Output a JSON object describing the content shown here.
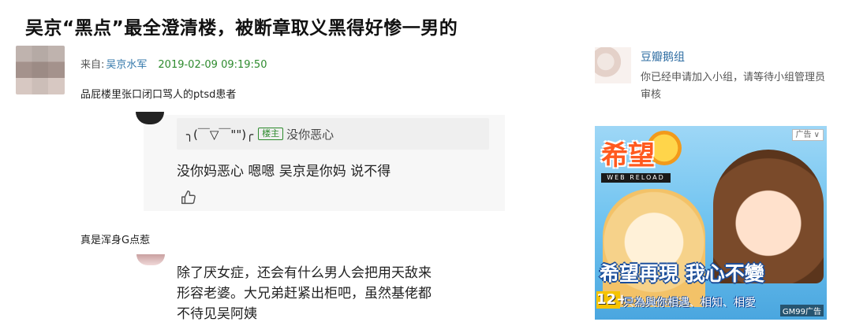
{
  "title": "吴京“黑点”最全澄清楼，被断章取义黑得好惨一男的",
  "post": {
    "from_label": "来自:",
    "author": "吴京水军",
    "date": "2019-02-09 09:19:50",
    "text": "品屁楼里张口闭口骂人的ptsd患者"
  },
  "reply1": {
    "quote_nick": "╮(￣▽￣\"\")╭",
    "badge": "楼主",
    "quote_text": "没你恶心",
    "text": "没你妈恶心 嗯嗯 吴京是你妈 说不得",
    "like_icon": "thumbs-up-icon"
  },
  "comment2": {
    "text": "真是浑身G点惹"
  },
  "reply2": {
    "lines": [
      "除了厌女症，还会有什么男人会把用天敌来",
      "形容老婆。大兄弟赶紧出柜吧，虽然基佬都",
      "不待见吴阿姨"
    ]
  },
  "sidebar": {
    "group_name": "豆瓣鹅组",
    "group_desc": "你已经申请加入小组，请等待小组管理员审核"
  },
  "ad": {
    "label": "广告 ∨",
    "logo": "希望",
    "web_reload": "WEB RELOAD",
    "slogan": "希望再現 我心不變",
    "age": "12+",
    "tagline": "只為與你相遇、相知、相愛",
    "brand": "GM99广告"
  }
}
